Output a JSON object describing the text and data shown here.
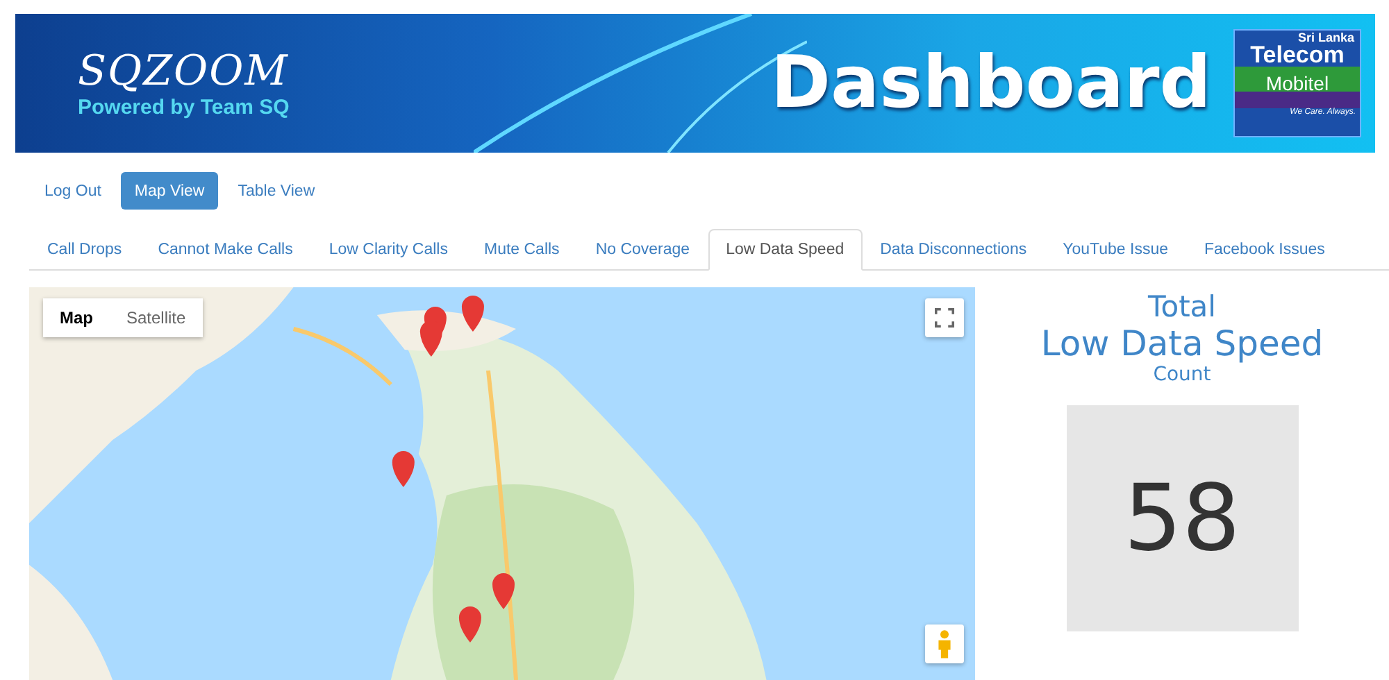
{
  "banner": {
    "logo": "SQZOOM",
    "tagline": "Powered by Team SQ",
    "title": "Dashboard",
    "brand": {
      "top": "Sri Lanka",
      "name": "Telecom",
      "sub": "Mobitel",
      "slogan": "We Care. Always."
    }
  },
  "nav": [
    {
      "label": "Log Out",
      "selected": false
    },
    {
      "label": "Map View",
      "selected": true
    },
    {
      "label": "Table View",
      "selected": false
    }
  ],
  "tabs": [
    {
      "label": "Call Drops",
      "selected": false
    },
    {
      "label": "Cannot Make Calls",
      "selected": false
    },
    {
      "label": "Low Clarity Calls",
      "selected": false
    },
    {
      "label": "Mute Calls",
      "selected": false
    },
    {
      "label": "No Coverage",
      "selected": false
    },
    {
      "label": "Low Data Speed",
      "selected": true
    },
    {
      "label": "Data Disconnections",
      "selected": false
    },
    {
      "label": "YouTube Issue",
      "selected": false
    },
    {
      "label": "Facebook Issues",
      "selected": false
    }
  ],
  "map": {
    "kind": "picture",
    "types": [
      {
        "label": "Map",
        "selected": true
      },
      {
        "label": "Satellite",
        "selected": false
      }
    ]
  },
  "summary": {
    "line1": "Total",
    "line2": "Low Data Speed",
    "line3": "Count",
    "value": "58"
  }
}
